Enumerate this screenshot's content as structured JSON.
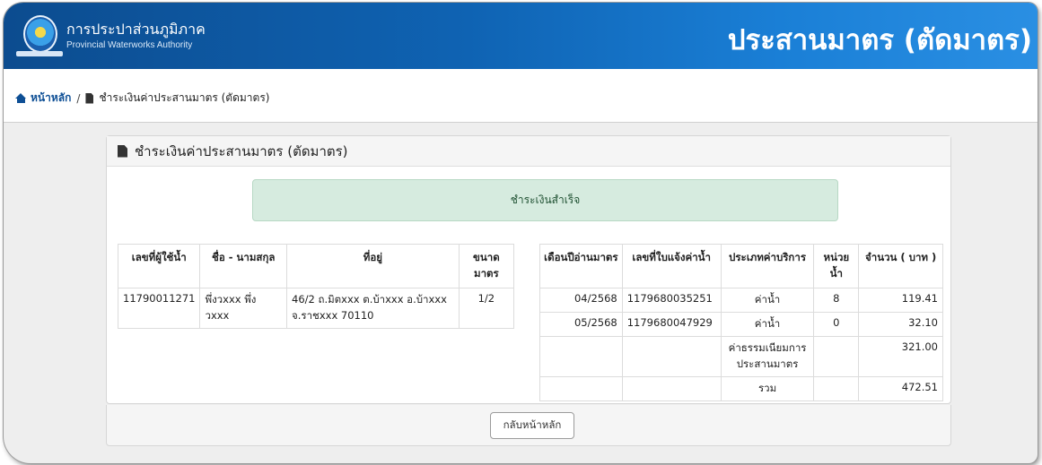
{
  "header": {
    "org_name_th": "การประปาส่วนภูมิภาค",
    "org_name_en": "Provincial Waterworks Authority",
    "page_heading": "ประสานมาตร (ตัดมาตร)"
  },
  "breadcrumb": {
    "home": "หน้าหลัก",
    "separator": "/",
    "current": "ชำระเงินค่าประสานมาตร (ตัดมาตร)"
  },
  "card": {
    "title": "ชำระเงินค่าประสานมาตร (ตัดมาตร)",
    "alert": "ชำระเงินสำเร็จ"
  },
  "customer_table": {
    "headers": [
      "เลขที่ผู้ใช้น้ำ",
      "ชื่อ - นามสกุล",
      "ที่อยู่",
      "ขนาดมาตร"
    ],
    "row": {
      "user_no": "11790011271",
      "name": "พึ่งวxxx พึ่ง วxxx",
      "address": "46/2 ถ.มิตxxx ต.บ้าxxx อ.บ้าxxx จ.ราชxxx 70110",
      "meter_size": "1/2"
    }
  },
  "billing_table": {
    "headers": [
      "เดือนปีอ่านมาตร",
      "เลขที่ใบแจ้งค่าน้ำ",
      "ประเภทค่าบริการ",
      "หน่วยน้ำ",
      "จำนวน ( บาท )"
    ],
    "rows": [
      {
        "month": "04/2568",
        "bill_no": "1179680035251",
        "type": "ค่าน้ำ",
        "units": "8",
        "amount": "119.41"
      },
      {
        "month": "05/2568",
        "bill_no": "1179680047929",
        "type": "ค่าน้ำ",
        "units": "0",
        "amount": "32.10"
      },
      {
        "month": "",
        "bill_no": "",
        "type": "ค่าธรรมเนียมการประสานมาตร",
        "units": "",
        "amount": "321.00"
      },
      {
        "month": "",
        "bill_no": "",
        "type": "รวม",
        "units": "",
        "amount": "472.51"
      }
    ]
  },
  "footer": {
    "back_label": "กลับหน้าหลัก"
  },
  "colors": {
    "header_blue": "#0f63b3",
    "alert_bg": "#d6ebdf",
    "link_blue": "#0e4f95"
  },
  "icons": [
    "logo",
    "home-icon",
    "file-icon"
  ]
}
